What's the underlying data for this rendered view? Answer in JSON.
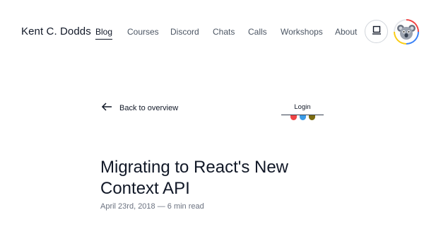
{
  "header": {
    "brand": "Kent C. Dodds",
    "nav": [
      "Blog",
      "Courses",
      "Discord",
      "Chats",
      "Calls",
      "Workshops",
      "About"
    ],
    "active_nav": "Blog",
    "theme_toggle_icon": "monitor-icon",
    "avatar_icon": "koala-avatar-icon"
  },
  "back_link": {
    "label": "Back to overview",
    "icon": "arrow-left-icon"
  },
  "login": {
    "label": "Login",
    "dot_colors": [
      "#ef4444",
      "#3b9be6",
      "#7a6a10"
    ]
  },
  "article": {
    "title": "Migrating to React's New Context API",
    "meta": "April 23rd, 2018 — 6 min read"
  },
  "colors": {
    "text": "#111827",
    "muted": "#6b7280",
    "background": "#ffffff"
  }
}
